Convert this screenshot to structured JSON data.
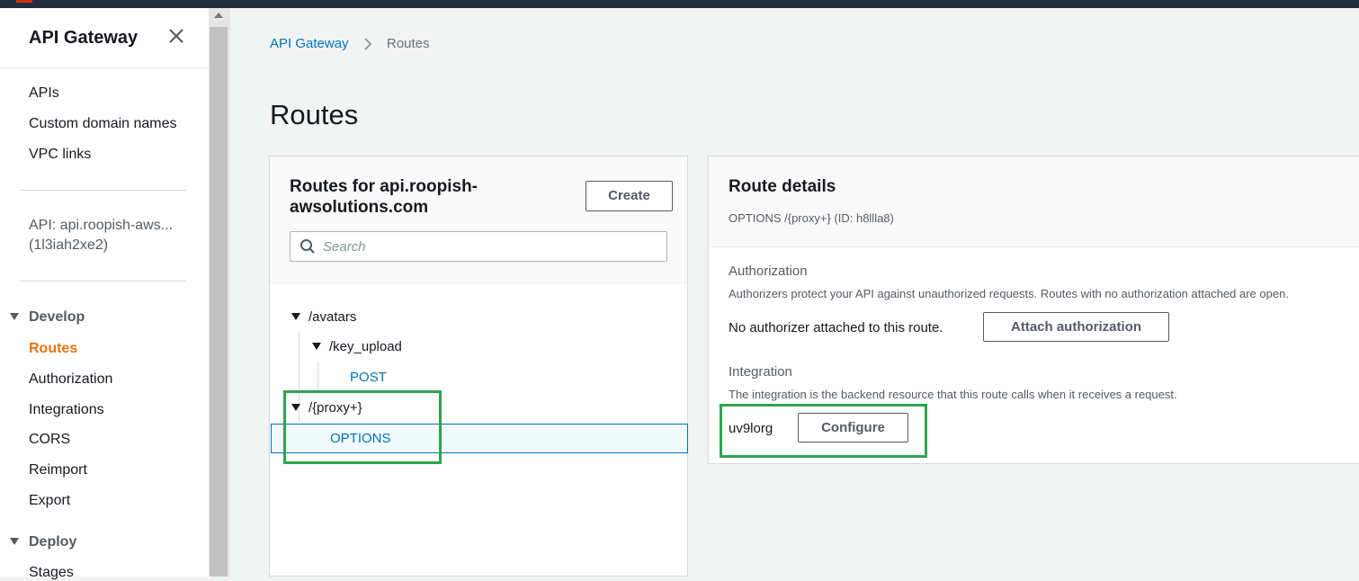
{
  "sidebar": {
    "title": "API Gateway",
    "links": [
      "APIs",
      "Custom domain names",
      "VPC links"
    ],
    "api_name": "API: api.roopish-aws...",
    "api_id": "(1l3iah2xe2)",
    "develop": {
      "label": "Develop",
      "items": [
        {
          "label": "Routes",
          "active": true
        },
        {
          "label": "Authorization"
        },
        {
          "label": "Integrations"
        },
        {
          "label": "CORS"
        },
        {
          "label": "Reimport"
        },
        {
          "label": "Export"
        }
      ]
    },
    "deploy": {
      "label": "Deploy",
      "items": [
        {
          "label": "Stages"
        }
      ]
    }
  },
  "breadcrumb": {
    "parent": "API Gateway",
    "current": "Routes"
  },
  "page_title": "Routes",
  "routes_panel": {
    "title": "Routes for api.roopish-awsolutions.com",
    "title_line1": "Routes for api.roopish-",
    "title_line2": "awsolutions.com",
    "create_label": "Create",
    "search_placeholder": "Search",
    "tree": {
      "avatars": "/avatars",
      "key_upload": "/key_upload",
      "post": "POST",
      "proxy": "/{proxy+}",
      "options": "OPTIONS"
    }
  },
  "route_details": {
    "title": "Route details",
    "subtitle": "OPTIONS /{proxy+} (ID: h8llla8)",
    "authorization": {
      "label": "Authorization",
      "description": "Authorizers protect your API against unauthorized requests. Routes with no authorization attached are open.",
      "status": "No authorizer attached to this route.",
      "button": "Attach authorization"
    },
    "integration": {
      "label": "Integration",
      "description": "The integration is the backend resource that this route calls when it receives a request.",
      "value": "uv9lorg",
      "button": "Configure"
    }
  },
  "colors": {
    "accent_active": "#ec7211",
    "link": "#0073bb",
    "highlight": "#2ea44f",
    "topbar": "#232f3e"
  }
}
